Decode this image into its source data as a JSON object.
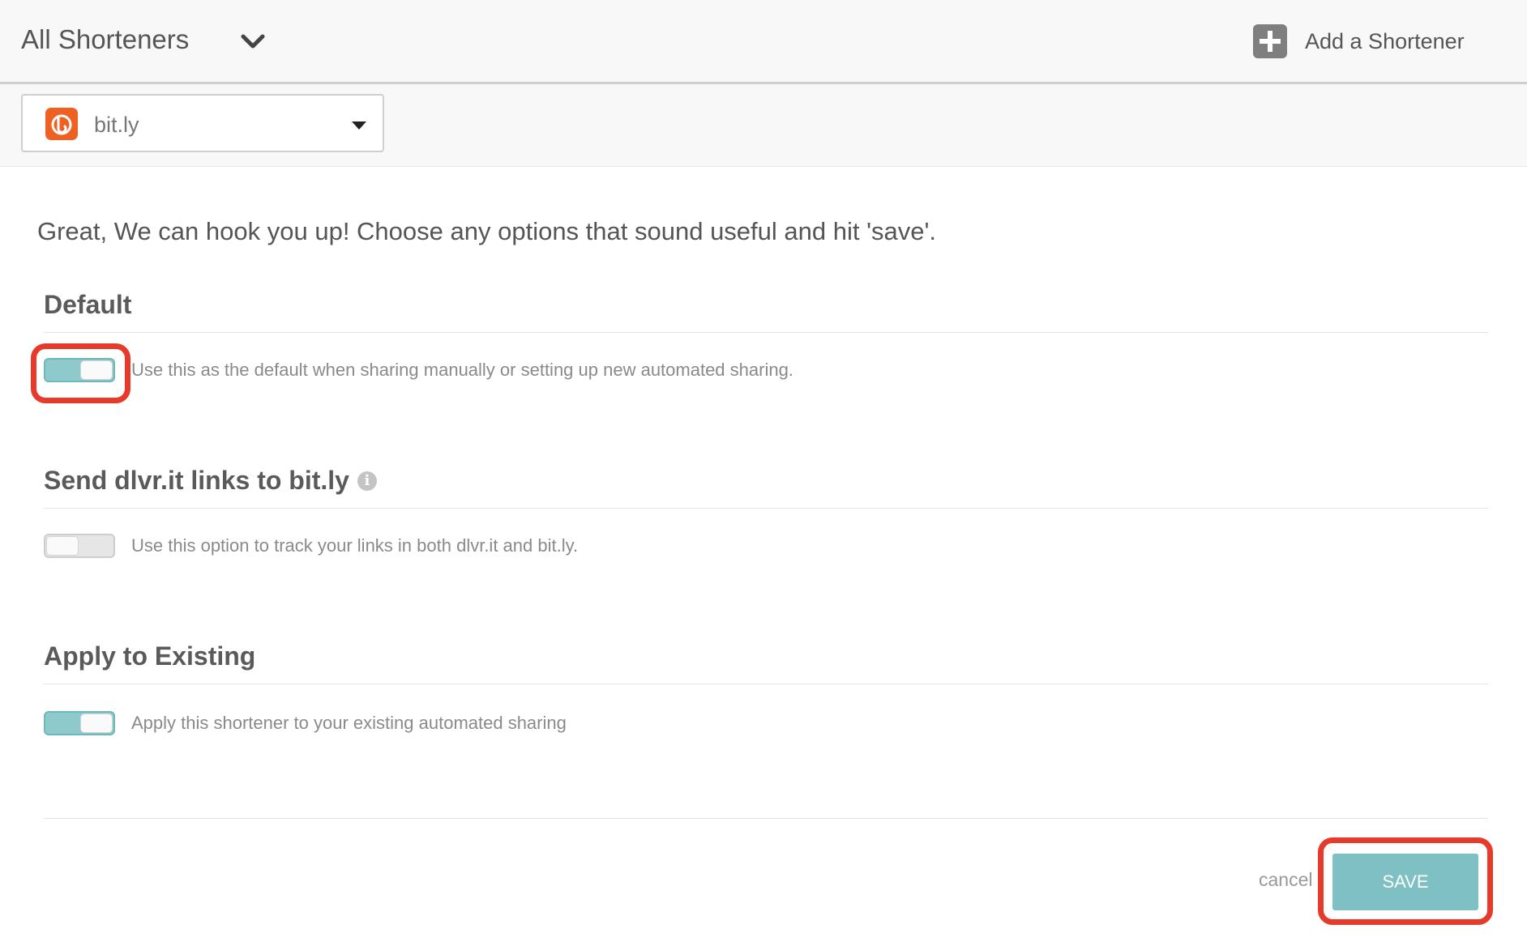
{
  "header": {
    "title": "All Shorteners",
    "add_label": "Add a Shortener"
  },
  "selector": {
    "value": "bit.ly"
  },
  "intro": "Great, We can hook you up! Choose any options that sound useful and hit 'save'.",
  "sections": [
    {
      "heading": "Default",
      "toggle_on": true,
      "description": "Use this as the default when sharing manually or setting up new automated sharing."
    },
    {
      "heading": "Send dlvr.it links to bit.ly",
      "info_icon": "i",
      "toggle_on": false,
      "description": "Use this option to track your links in both dlvr.it and bit.ly."
    },
    {
      "heading": "Apply to Existing",
      "toggle_on": true,
      "description": "Apply this shortener to your existing automated sharing"
    }
  ],
  "footer": {
    "cancel_label": "cancel",
    "save_label": "SAVE"
  },
  "colors": {
    "accent": "#7ec0c4",
    "toggle_on": "#8ec9cc",
    "highlight": "#e63a2a",
    "bitly_orange": "#ee6123"
  }
}
